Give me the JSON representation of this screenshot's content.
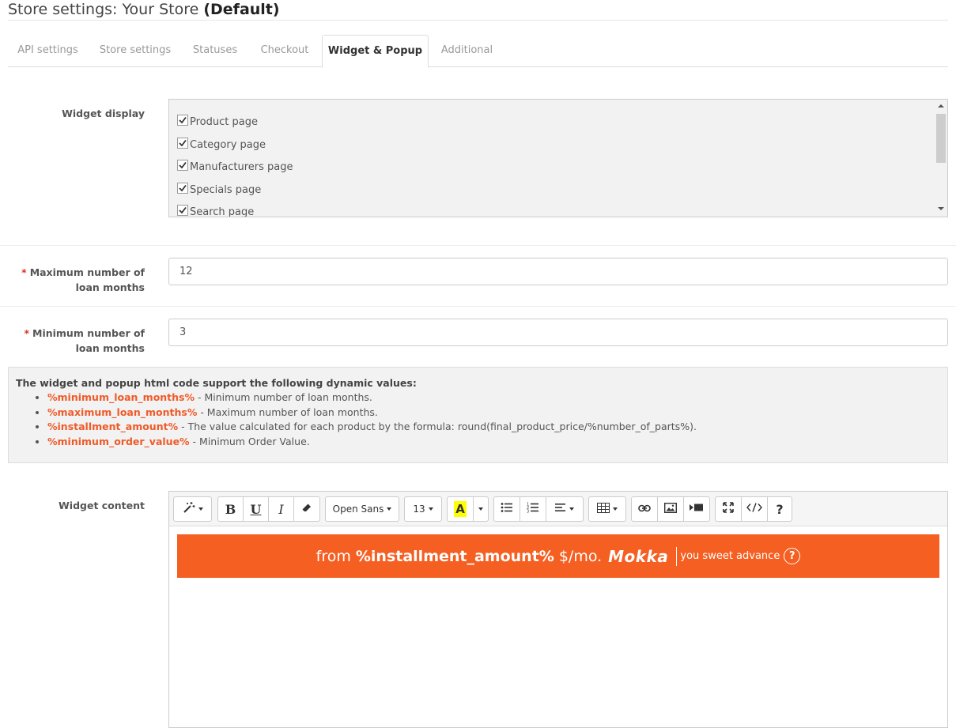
{
  "header": {
    "title_prefix": "Store settings: Your Store",
    "title_bold": "(Default)"
  },
  "tabs": [
    {
      "label": "API settings",
      "active": false
    },
    {
      "label": "Store settings",
      "active": false
    },
    {
      "label": "Statuses",
      "active": false
    },
    {
      "label": "Checkout",
      "active": false
    },
    {
      "label": "Widget & Popup",
      "active": true
    },
    {
      "label": "Additional",
      "active": false
    }
  ],
  "widget_display": {
    "label": "Widget display",
    "items": [
      {
        "label": "Product page",
        "checked": true
      },
      {
        "label": "Category page",
        "checked": true
      },
      {
        "label": "Manufacturers page",
        "checked": true
      },
      {
        "label": "Specials page",
        "checked": true
      },
      {
        "label": "Search page",
        "checked": true
      }
    ]
  },
  "max_months": {
    "required_mark": "*",
    "label_line1": "Maximum number of",
    "label_line2": "loan months",
    "value": "12"
  },
  "min_months": {
    "required_mark": "*",
    "label_line1": "Minimum number of",
    "label_line2": "loan months",
    "value": "3"
  },
  "info": {
    "title": "The widget and popup html code support the following dynamic values:",
    "items": [
      {
        "var": "%minimum_loan_months%",
        "desc": " - Minimum number of loan months."
      },
      {
        "var": "%maximum_loan_months%",
        "desc": " - Maximum number of loan months."
      },
      {
        "var": "%installment_amount%",
        "desc": " - The value calculated for each product by the formula: round(final_product_price/%number_of_parts%)."
      },
      {
        "var": "%minimum_order_value%",
        "desc": " - Minimum Order Value."
      }
    ],
    "accent_color": "#f05a28"
  },
  "widget_content": {
    "label": "Widget content",
    "toolbar": {
      "font_name": "Open Sans",
      "font_size": "13",
      "bold": "B",
      "underline": "U",
      "italic": "I",
      "highlight": "A",
      "help": "?"
    },
    "banner": {
      "from": "from",
      "variable": "%installment_amount%",
      "per_month": "$/mo.",
      "logo": "Mokka",
      "tagline": "you sweet advance",
      "help": "?",
      "background": "#f55f22"
    }
  }
}
